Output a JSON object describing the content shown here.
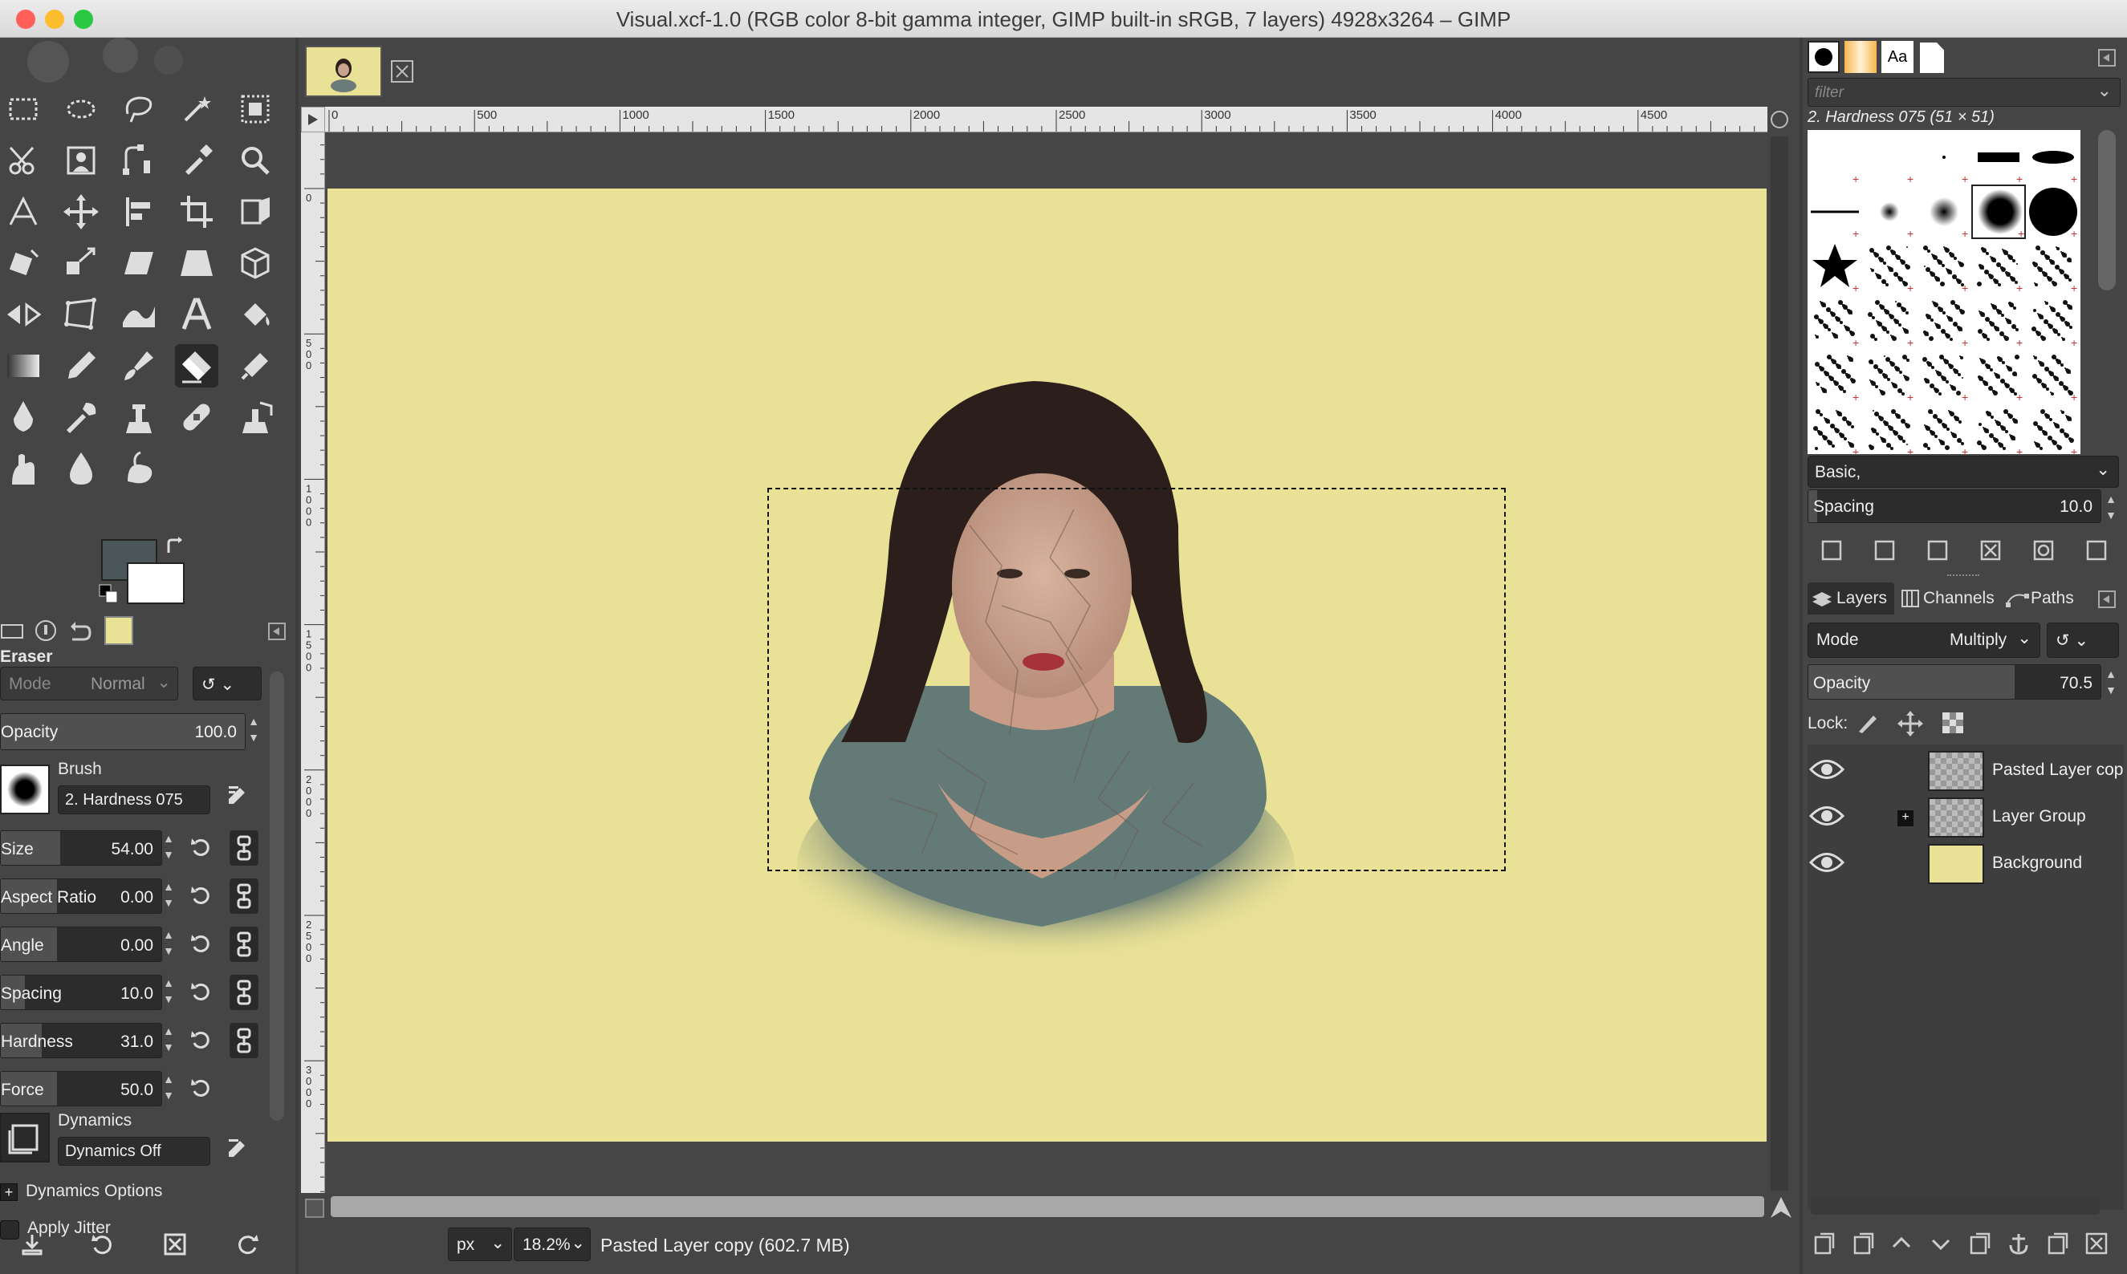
{
  "window": {
    "title": "Visual.xcf-1.0 (RGB color 8-bit gamma integer, GIMP built-in sRGB, 7 layers) 4928x3264 – GIMP"
  },
  "colors": {
    "foreground": "#4a5658",
    "background": "#ffffff",
    "canvas": "#e9e196",
    "accent_red": "#ff5f57",
    "accent_yellow": "#febc2e",
    "accent_green": "#28c840"
  },
  "toolbox": {
    "tools": [
      "rect-select",
      "ellipse-select",
      "free-select",
      "fuzzy-select",
      "select-by-color",
      "scissors",
      "foreground-select",
      "paths",
      "color-picker",
      "zoom",
      "measure",
      "move",
      "align",
      "crop",
      "unified-transform",
      "rotate",
      "scale",
      "shear",
      "perspective",
      "3d-transform",
      "flip",
      "cage",
      "warp",
      "text",
      "bucket-fill",
      "gradient",
      "pencil",
      "paintbrush",
      "eraser",
      "airbrush",
      "ink",
      "mypaint",
      "clone",
      "heal",
      "perspective-clone",
      "smudge",
      "blur",
      "dodge-burn"
    ],
    "active_tool": "eraser"
  },
  "tool_options": {
    "title": "Eraser",
    "mode_label": "Mode",
    "mode_value": "Normal",
    "opacity": {
      "label": "Opacity",
      "value": "100.0"
    },
    "brush_label": "Brush",
    "brush_name": "2. Hardness 075",
    "size": {
      "label": "Size",
      "value": "54.00"
    },
    "aspect_ratio": {
      "label": "Aspect Ratio",
      "value": "0.00"
    },
    "angle": {
      "label": "Angle",
      "value": "0.00"
    },
    "spacing": {
      "label": "Spacing",
      "value": "10.0"
    },
    "hardness": {
      "label": "Hardness",
      "value": "31.0"
    },
    "force": {
      "label": "Force",
      "value": "50.0"
    },
    "dynamics_label": "Dynamics",
    "dynamics_name": "Dynamics Off",
    "dynamics_options": "Dynamics Options",
    "apply_jitter": "Apply Jitter"
  },
  "rulers": {
    "h_ticks": [
      "0",
      "500",
      "1000",
      "1500",
      "2000",
      "2500",
      "3000",
      "3500",
      "4000",
      "4500"
    ],
    "v_ticks": [
      "0",
      "500",
      "1000",
      "1500",
      "2000",
      "2500",
      "3000"
    ]
  },
  "statusbar": {
    "unit": "px",
    "zoom": "18.2%",
    "message": "Pasted Layer copy (602.7 MB)"
  },
  "brushes": {
    "filter_placeholder": "filter",
    "selected": "2. Hardness 075 (51 × 51)",
    "tag": "Basic,",
    "spacing": {
      "label": "Spacing",
      "value": "10.0"
    }
  },
  "layers_panel": {
    "tabs": [
      "Layers",
      "Channels",
      "Paths"
    ],
    "mode_label": "Mode",
    "mode_value": "Multiply",
    "opacity": {
      "label": "Opacity",
      "value": "70.5"
    },
    "lock_label": "Lock:",
    "layers": [
      {
        "name": "Pasted Layer cop",
        "visible": true
      },
      {
        "name": "Layer Group",
        "visible": true
      },
      {
        "name": "Background",
        "visible": true
      }
    ]
  }
}
